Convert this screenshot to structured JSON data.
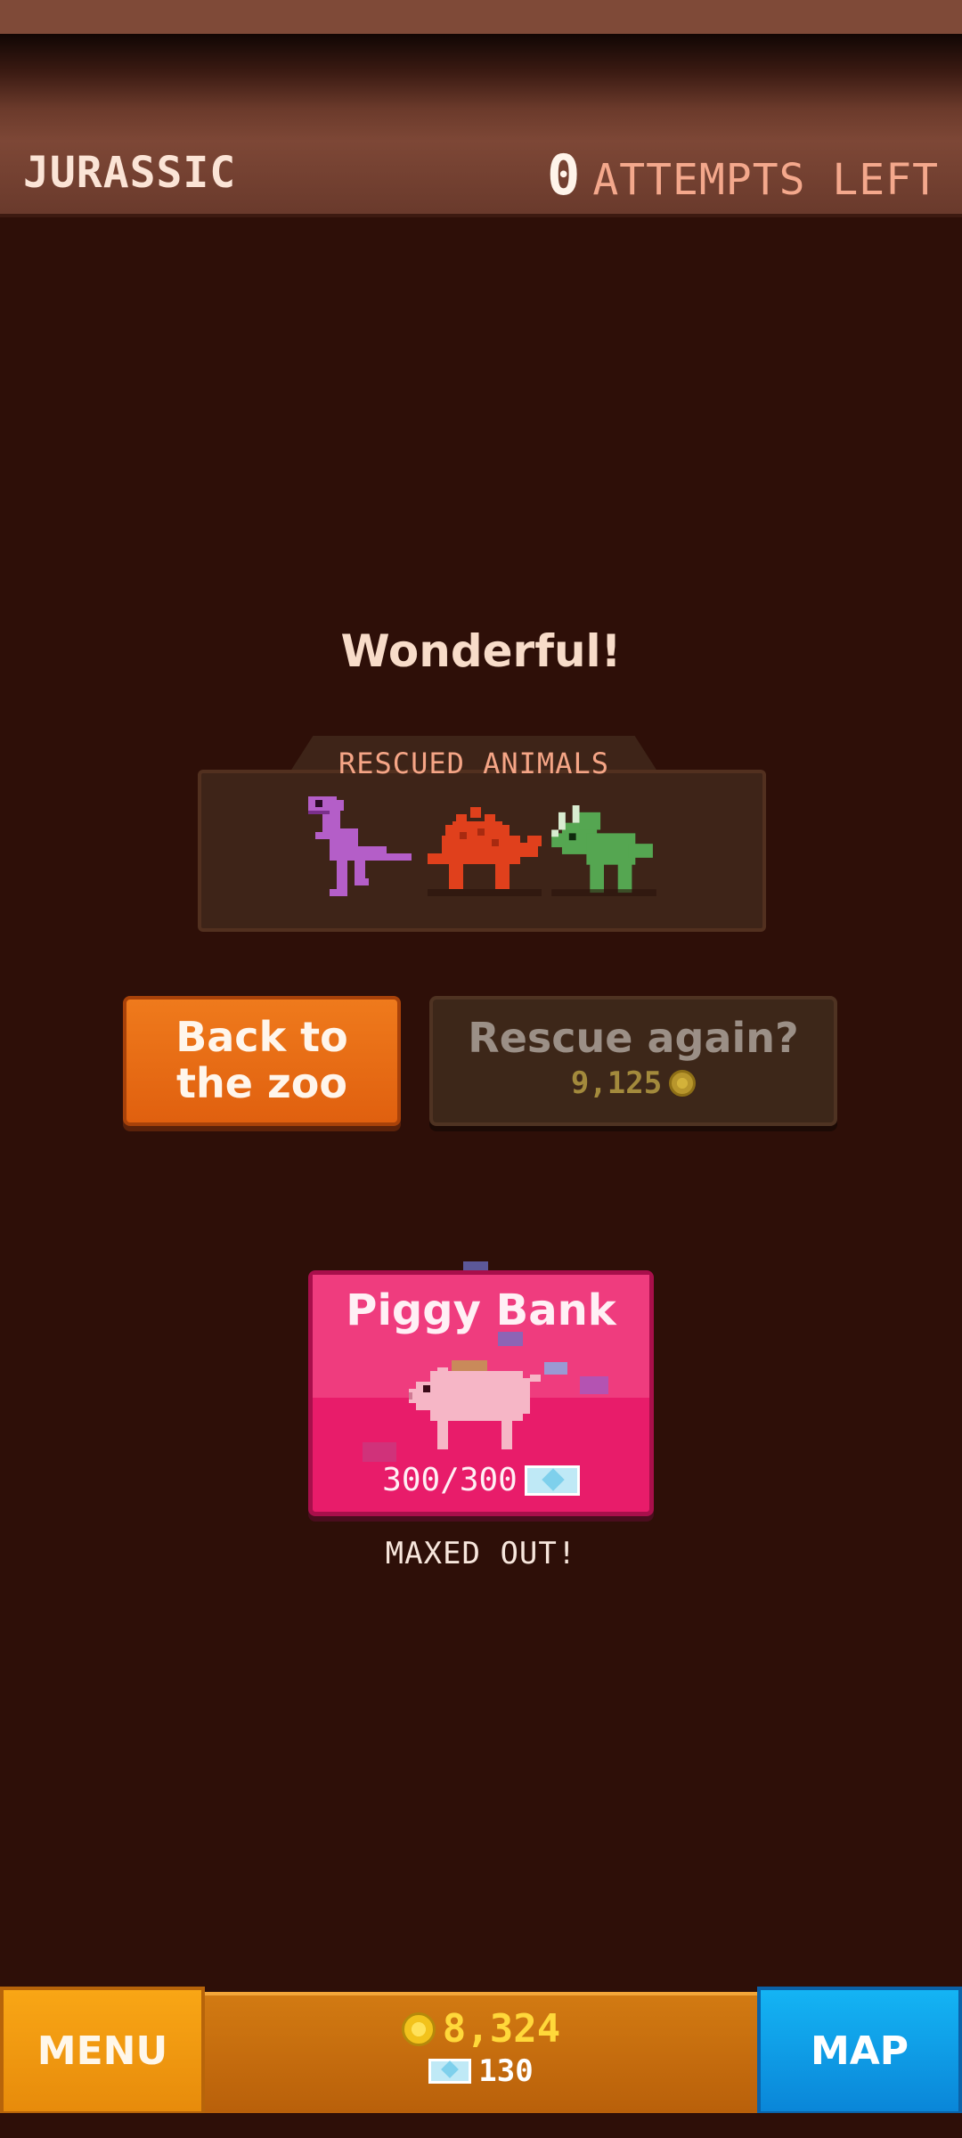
{
  "header": {
    "level_name": "JURASSIC",
    "attempts_count": "0",
    "attempts_label": "ATTEMPTS LEFT"
  },
  "headline": "Wonderful!",
  "rescued": {
    "title": "RESCUED ANIMALS",
    "animals": [
      {
        "icon": "purple-t-rex-icon",
        "color": "#b45ec8"
      },
      {
        "icon": "red-stegosaurus-icon",
        "color": "#e0401c"
      },
      {
        "icon": "green-triceratops-icon",
        "color": "#55a651"
      }
    ]
  },
  "buttons": {
    "back_line1": "Back to",
    "back_line2": "the zoo",
    "rescue_label": "Rescue again?",
    "rescue_price": "9,125"
  },
  "piggy_bank": {
    "title": "Piggy Bank",
    "progress": "300/300",
    "status": "MAXED OUT!"
  },
  "bottom_bar": {
    "menu_label": "MENU",
    "map_label": "MAP",
    "coins": "8,324",
    "gems": "130"
  },
  "colors": {
    "background": "#2e0f08",
    "accent_orange": "#e86a14",
    "piggy_pink": "#e81c6a",
    "map_blue": "#14a6ee"
  }
}
